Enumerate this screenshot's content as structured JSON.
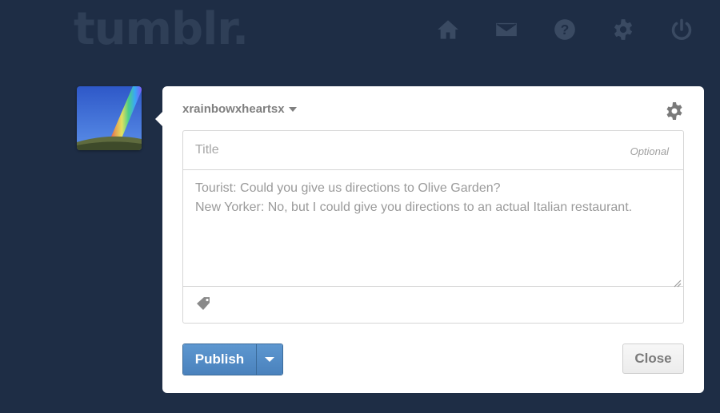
{
  "header": {
    "logo": "tumblr.",
    "nav_icons": [
      "home-icon",
      "mail-icon",
      "help-icon",
      "gear-icon",
      "power-icon"
    ]
  },
  "post": {
    "blog_name": "xrainbowxheartsx",
    "title_placeholder": "Title",
    "title_hint": "Optional",
    "body_lines": [
      "Tourist: Could you give us directions to Olive Garden?",
      "New Yorker: No, but I could give you directions to an actual Italian restaurant."
    ],
    "publish_label": "Publish",
    "close_label": "Close"
  },
  "colors": {
    "background": "#1e2d45",
    "accent": "#4a82bd"
  }
}
